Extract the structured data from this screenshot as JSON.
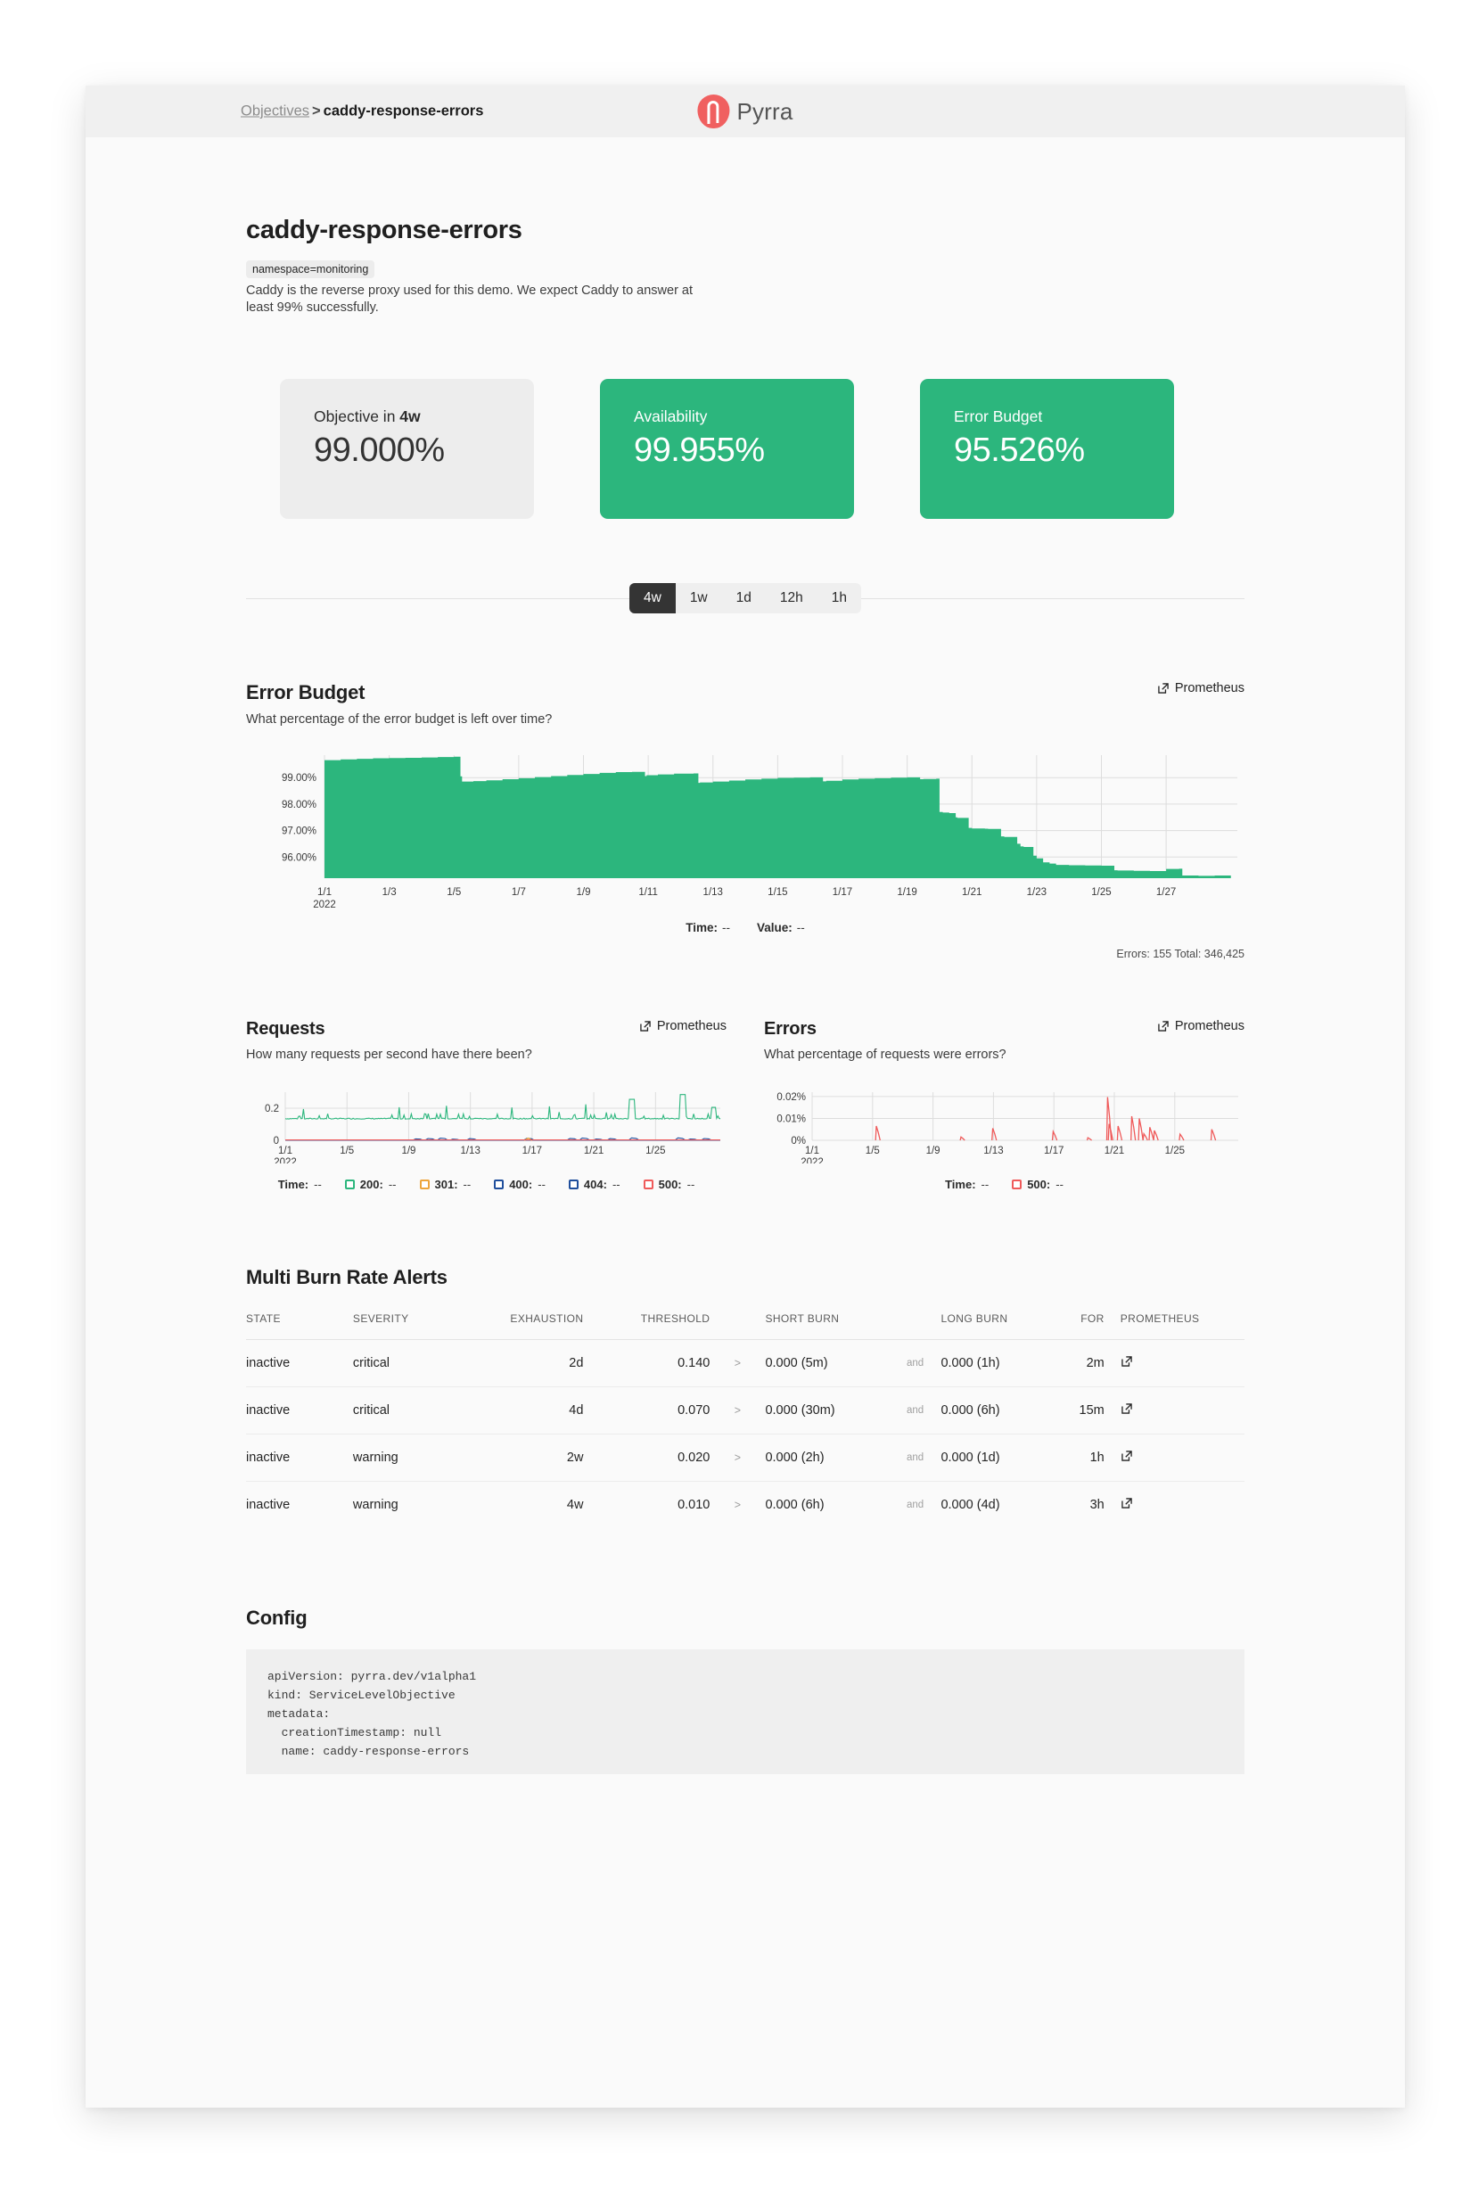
{
  "header": {
    "breadcrumb_parent": "Objectives",
    "breadcrumb_sep": ">",
    "breadcrumb_current": "caddy-response-errors",
    "brand": "Pyrra",
    "logo_icon": "pyrra-logo-icon",
    "logo_color": "#f06060"
  },
  "objective": {
    "title": "caddy-response-errors",
    "label_chip": "namespace=monitoring",
    "description": "Caddy is the reverse proxy used for this demo. We expect Caddy to answer at least 99% successfully."
  },
  "cards": [
    {
      "label_prefix": "Objective in ",
      "label_strong": "4w",
      "value": "99.000%",
      "style": "neutral"
    },
    {
      "label_prefix": "Availability",
      "label_strong": "",
      "value": "99.955%",
      "style": "green"
    },
    {
      "label_prefix": "Error Budget",
      "label_strong": "",
      "value": "95.526%",
      "style": "green"
    }
  ],
  "time_ranges": {
    "options": [
      "4w",
      "1w",
      "1d",
      "12h",
      "1h"
    ],
    "selected": "4w"
  },
  "colors": {
    "green": "#2cb67d",
    "red": "#ef5a5a",
    "orange": "#eda53c",
    "blue": "#1f4e9c",
    "dark": "#343434"
  },
  "budget_panel": {
    "title": "Error Budget",
    "subtitle": "What percentage of the error budget is left over time?",
    "prometheus_label": "Prometheus",
    "prometheus_icon": "external-link-icon",
    "tooltip_time_key": "Time:",
    "tooltip_time_value": "--",
    "tooltip_value_key": "Value:",
    "tooltip_value_value": "--",
    "counts": "Errors: 155 Total: 346,425"
  },
  "requests_panel": {
    "title": "Requests",
    "subtitle": "How many requests per second have there been?",
    "prometheus_label": "Prometheus",
    "prometheus_icon": "external-link-icon",
    "legend": [
      {
        "key": "Time:",
        "value": "--",
        "color": ""
      },
      {
        "key": "200:",
        "value": "--",
        "color": "#2cb67d"
      },
      {
        "key": "301:",
        "value": "--",
        "color": "#eda53c"
      },
      {
        "key": "400:",
        "value": "--",
        "color": "#1f4e9c"
      },
      {
        "key": "404:",
        "value": "--",
        "color": "#1f4e9c"
      },
      {
        "key": "500:",
        "value": "--",
        "color": "#ef5a5a"
      }
    ]
  },
  "errors_panel": {
    "title": "Errors",
    "subtitle": "What percentage of requests were errors?",
    "prometheus_label": "Prometheus",
    "prometheus_icon": "external-link-icon",
    "legend": [
      {
        "key": "Time:",
        "value": "--",
        "color": ""
      },
      {
        "key": "500:",
        "value": "--",
        "color": "#ef5a5a"
      }
    ]
  },
  "alerts": {
    "title": "Multi Burn Rate Alerts",
    "columns": [
      "STATE",
      "SEVERITY",
      "EXHAUSTION",
      "THRESHOLD",
      "",
      "SHORT BURN",
      "",
      "LONG BURN",
      "FOR",
      "PROMETHEUS"
    ],
    "operator": ">",
    "conjunction": "and",
    "link_icon": "external-link-icon",
    "rows": [
      {
        "state": "inactive",
        "severity": "critical",
        "exhaustion": "2d",
        "threshold": "0.140",
        "short_burn": "0.000 (5m)",
        "long_burn": "0.000 (1h)",
        "for": "2m"
      },
      {
        "state": "inactive",
        "severity": "critical",
        "exhaustion": "4d",
        "threshold": "0.070",
        "short_burn": "0.000 (30m)",
        "long_burn": "0.000 (6h)",
        "for": "15m"
      },
      {
        "state": "inactive",
        "severity": "warning",
        "exhaustion": "2w",
        "threshold": "0.020",
        "short_burn": "0.000 (2h)",
        "long_burn": "0.000 (1d)",
        "for": "1h"
      },
      {
        "state": "inactive",
        "severity": "warning",
        "exhaustion": "4w",
        "threshold": "0.010",
        "short_burn": "0.000 (6h)",
        "long_burn": "0.000 (4d)",
        "for": "3h"
      }
    ]
  },
  "config": {
    "title": "Config",
    "code": "apiVersion: pyrra.dev/v1alpha1\nkind: ServiceLevelObjective\nmetadata:\n  creationTimestamp: null\n  name: caddy-response-errors"
  },
  "chart_data": [
    {
      "type": "area",
      "name": "error-budget",
      "title": "Error Budget",
      "xlabel": "",
      "ylabel": "",
      "year_label": "2022",
      "grid": true,
      "ylim": [
        95.2,
        99.85
      ],
      "yticks": [
        "96.00%",
        "97.00%",
        "98.00%",
        "99.00%"
      ],
      "ytick_values": [
        96.0,
        97.0,
        98.0,
        99.0
      ],
      "xticks": [
        "1/1",
        "1/3",
        "1/5",
        "1/7",
        "1/9",
        "1/11",
        "1/13",
        "1/15",
        "1/17",
        "1/19",
        "1/21",
        "1/23",
        "1/25",
        "1/27"
      ],
      "series": [
        {
          "name": "budget",
          "color": "#2cb67d",
          "x": [
            1.0,
            1.5,
            2.0,
            2.5,
            3.0,
            3.5,
            4.0,
            4.5,
            5.0,
            5.2,
            5.25,
            5.6,
            6.0,
            6.5,
            7.0,
            7.5,
            8.0,
            8.5,
            9.0,
            9.5,
            10.0,
            10.5,
            10.9,
            10.95,
            11.3,
            11.8,
            12.4,
            12.55,
            12.6,
            13.0,
            13.5,
            14.0,
            14.5,
            15.0,
            15.5,
            16.0,
            16.4,
            16.5,
            17.0,
            17.5,
            18.0,
            18.5,
            19.0,
            19.4,
            19.5,
            19.9,
            20.0,
            20.1,
            20.3,
            20.5,
            20.55,
            20.9,
            21.0,
            21.4,
            21.5,
            21.9,
            22.0,
            22.4,
            22.5,
            22.6,
            22.9,
            23.0,
            23.2,
            23.4,
            23.6,
            24.0,
            24.5,
            25.0,
            25.4,
            25.5,
            26.0,
            26.5,
            27.0,
            27.4,
            27.5,
            28.0,
            28.5,
            29.0
          ],
          "y": [
            99.62,
            99.66,
            99.69,
            99.71,
            99.73,
            99.74,
            99.75,
            99.76,
            99.78,
            99.79,
            99.05,
            98.85,
            98.87,
            98.9,
            98.94,
            98.98,
            99.02,
            99.06,
            99.1,
            99.14,
            99.18,
            99.21,
            99.22,
            99.06,
            99.09,
            99.12,
            99.15,
            99.16,
            98.8,
            98.82,
            98.85,
            98.89,
            98.93,
            98.96,
            98.99,
            99.0,
            99.01,
            98.86,
            98.88,
            98.93,
            98.96,
            98.98,
            99.0,
            99.01,
            98.94,
            98.95,
            98.96,
            97.7,
            97.68,
            97.66,
            97.5,
            97.48,
            97.1,
            97.08,
            97.07,
            97.06,
            96.78,
            96.76,
            96.5,
            96.4,
            96.38,
            96.05,
            95.95,
            95.8,
            95.75,
            95.7,
            95.69,
            95.68,
            95.67,
            95.5,
            95.49,
            95.48,
            95.47,
            95.55,
            95.56,
            95.3,
            95.29,
            95.3
          ]
        }
      ]
    },
    {
      "type": "line",
      "name": "requests",
      "title": "Requests",
      "xlabel": "",
      "ylabel": "",
      "year_label": "2022",
      "grid": true,
      "ylim": [
        0,
        0.3
      ],
      "yticks": [
        "0",
        "0.2"
      ],
      "ytick_values": [
        0,
        0.2
      ],
      "xticks": [
        "1/1",
        "1/5",
        "1/9",
        "1/13",
        "1/17",
        "1/21",
        "1/25"
      ],
      "series": [
        {
          "name": "200",
          "color": "#2cb67d",
          "baseline": 0.135,
          "peak_max": 0.29
        },
        {
          "name": "301",
          "color": "#eda53c",
          "baseline": 0.0,
          "peak_max": 0.02
        },
        {
          "name": "400",
          "color": "#1f4e9c",
          "baseline": 0.0,
          "peak_max": 0.02
        },
        {
          "name": "404",
          "color": "#1f4e9c",
          "baseline": 0.0,
          "peak_max": 0.02
        },
        {
          "name": "500",
          "color": "#ef5a5a",
          "baseline": 0.002,
          "peak_max": 0.004
        }
      ]
    },
    {
      "type": "line",
      "name": "errors",
      "title": "Errors",
      "xlabel": "",
      "ylabel": "",
      "year_label": "2022",
      "grid": true,
      "ylim": [
        0,
        0.022
      ],
      "yticks": [
        "0%",
        "0.01%",
        "0.02%"
      ],
      "ytick_values": [
        0,
        0.01,
        0.02
      ],
      "xticks": [
        "1/1",
        "1/5",
        "1/9",
        "1/13",
        "1/17",
        "1/21",
        "1/25"
      ],
      "series": [
        {
          "name": "500",
          "color": "#ef5a5a",
          "spikes": [
            [
              5.2,
              0.0065
            ],
            [
              10.8,
              0.0015
            ],
            [
              12.9,
              0.0055
            ],
            [
              16.9,
              0.004
            ],
            [
              19.2,
              0.0012
            ],
            [
              20.5,
              0.0197
            ],
            [
              20.6,
              0.0075
            ],
            [
              21.2,
              0.0065
            ],
            [
              22.1,
              0.011
            ],
            [
              22.6,
              0.01
            ],
            [
              22.9,
              0.003
            ],
            [
              23.3,
              0.006
            ],
            [
              23.6,
              0.0045
            ],
            [
              25.3,
              0.0028
            ],
            [
              27.4,
              0.005
            ]
          ]
        }
      ]
    }
  ]
}
